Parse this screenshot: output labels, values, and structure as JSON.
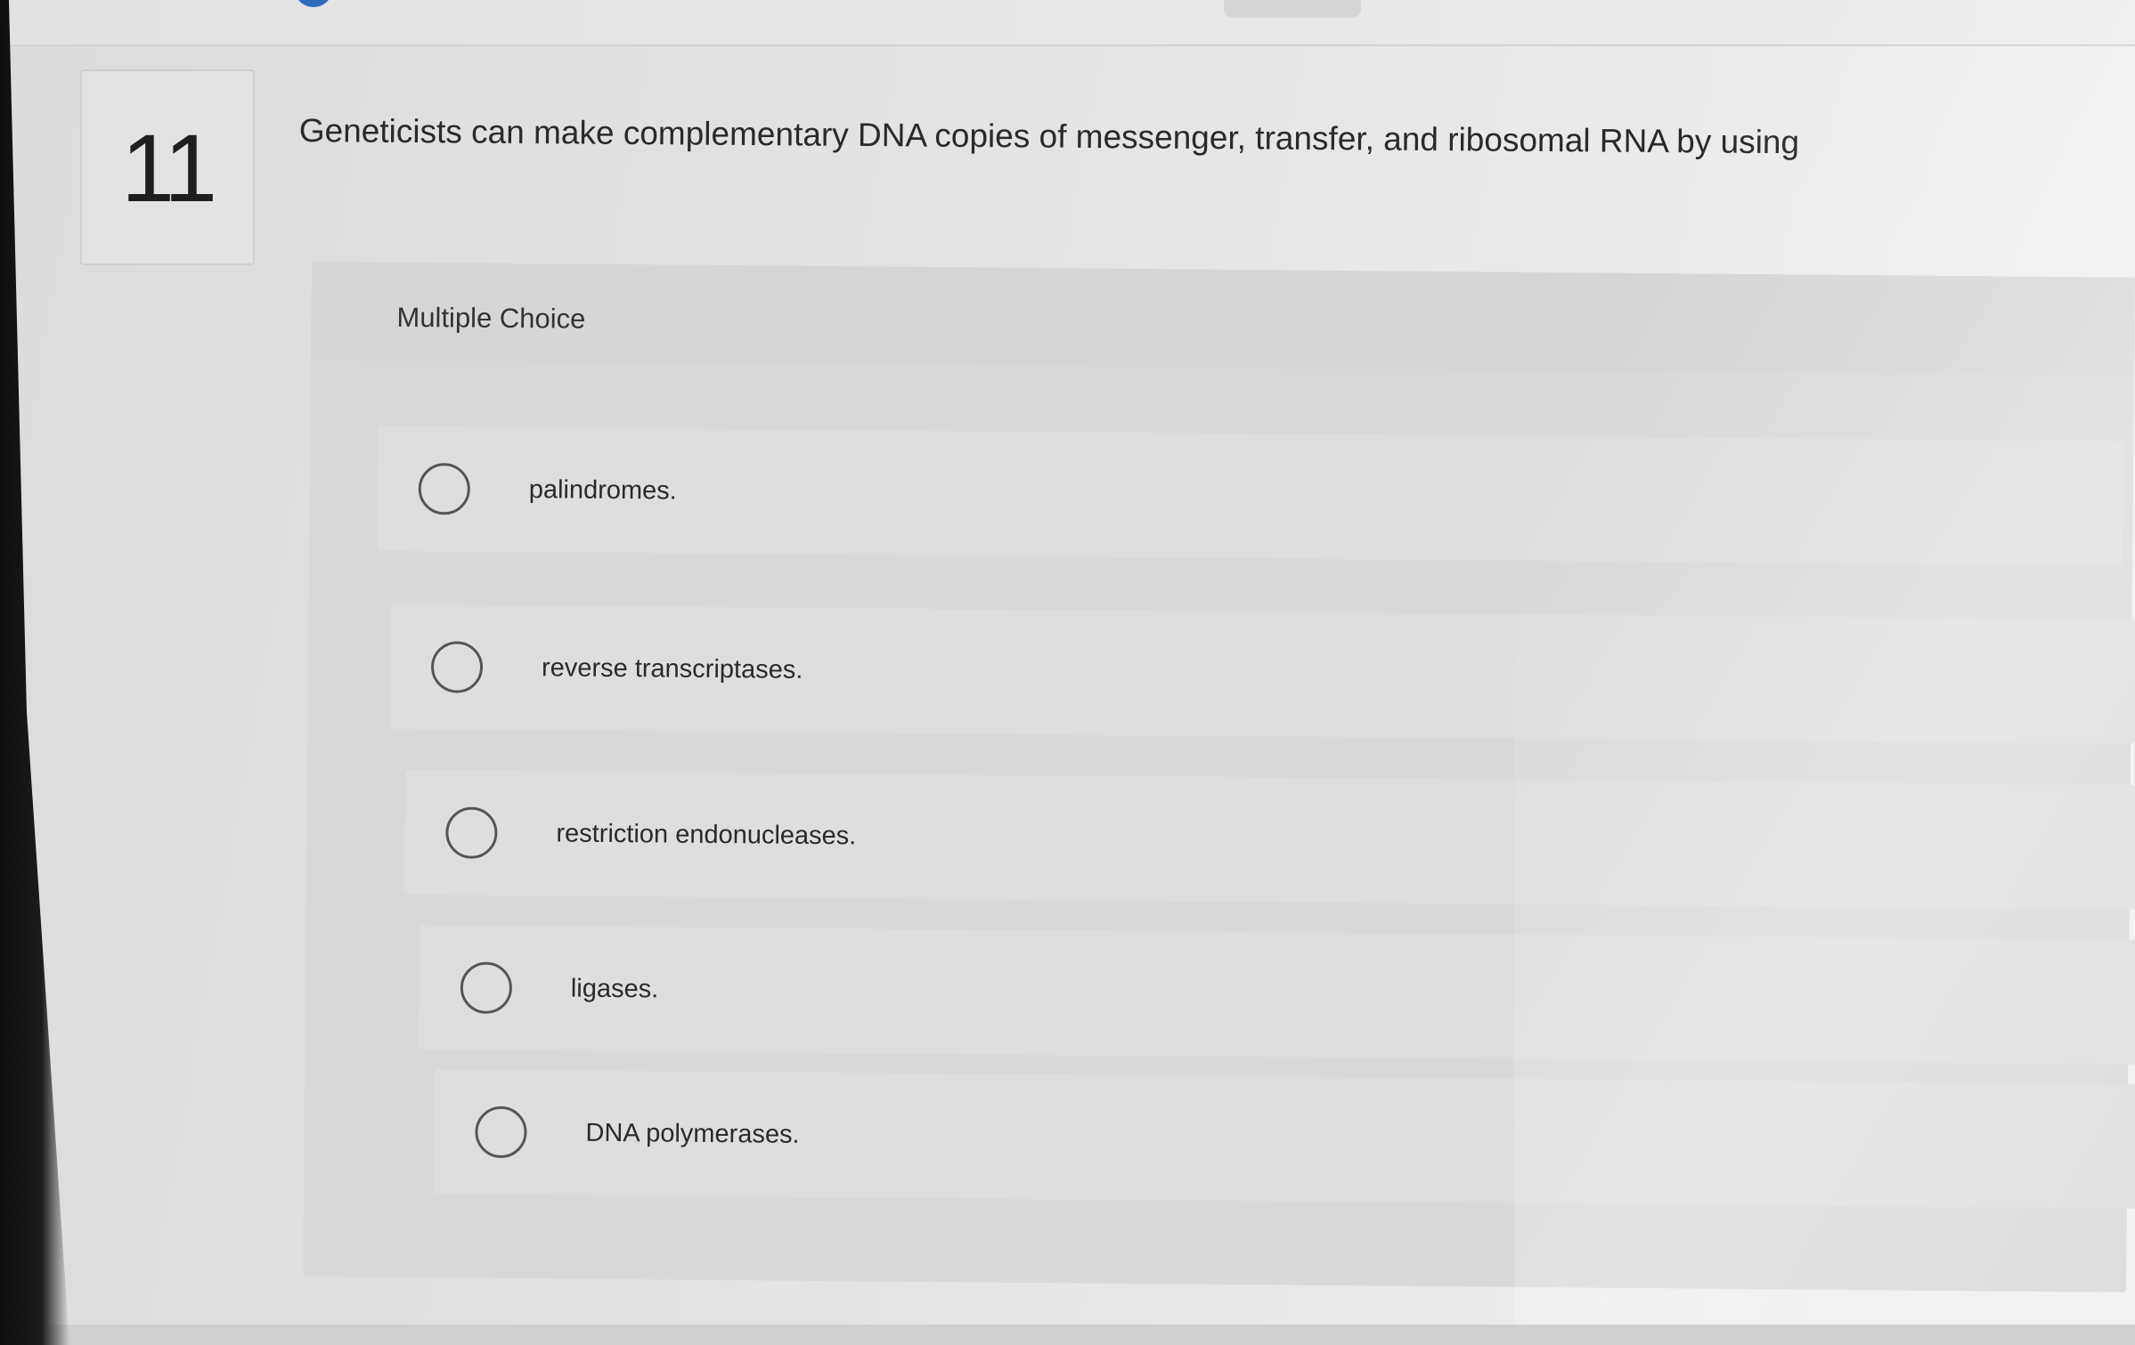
{
  "question": {
    "number": "11",
    "text": "Geneticists can make complementary DNA copies of messenger, transfer, and ribosomal RNA by using"
  },
  "panel": {
    "title": "Multiple Choice"
  },
  "options": [
    {
      "label": "palindromes."
    },
    {
      "label": "reverse transcriptases."
    },
    {
      "label": "restriction endonucleases."
    },
    {
      "label": "ligases."
    },
    {
      "label": "DNA polymerases."
    }
  ],
  "colors": {
    "accent": "#2e6ab8",
    "text": "#2a2a2a",
    "panel_bg": "#d9d9d9"
  }
}
